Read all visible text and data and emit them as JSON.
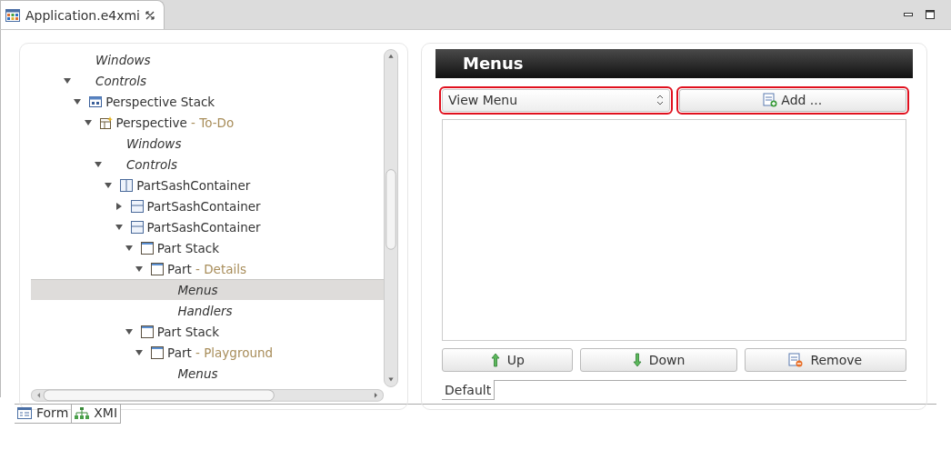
{
  "editor_tab": {
    "title": "Application.e4xmi",
    "selected": true
  },
  "tree": [
    {
      "label": "Windows",
      "kind": "folder",
      "selected": false
    },
    {
      "label": "Controls",
      "kind": "folder",
      "expanded": true,
      "selected": false,
      "children": [
        {
          "label": "Perspective Stack",
          "kind": "stack",
          "expanded": true,
          "selected": false,
          "children": [
            {
              "label": "Perspective",
              "detail": "- To-Do",
              "kind": "perspective",
              "expanded": true,
              "selected": false,
              "children": [
                {
                  "label": "Windows",
                  "kind": "folder",
                  "selected": false
                },
                {
                  "label": "Controls",
                  "kind": "folder",
                  "expanded": true,
                  "selected": false,
                  "children": [
                    {
                      "label": "PartSashContainer",
                      "kind": "sash-vertical",
                      "expanded": true,
                      "selected": false,
                      "children": [
                        {
                          "label": "PartSashContainer",
                          "kind": "sash-horizontal",
                          "expanded": false,
                          "selected": false
                        },
                        {
                          "label": "PartSashContainer",
                          "kind": "sash-horizontal",
                          "expanded": true,
                          "selected": false,
                          "children": [
                            {
                              "label": "Part Stack",
                              "kind": "part",
                              "expanded": true,
                              "selected": false,
                              "children": [
                                {
                                  "label": "Part",
                                  "detail": "- Details",
                                  "kind": "part",
                                  "expanded": true,
                                  "selected": false,
                                  "children": [
                                    {
                                      "label": "Menus",
                                      "kind": "folder",
                                      "selected": true
                                    },
                                    {
                                      "label": "Handlers",
                                      "kind": "folder",
                                      "selected": false
                                    }
                                  ]
                                }
                              ]
                            },
                            {
                              "label": "Part Stack",
                              "kind": "part",
                              "expanded": true,
                              "selected": false,
                              "children": [
                                {
                                  "label": "Part",
                                  "detail": "- Playground",
                                  "kind": "part",
                                  "expanded": true,
                                  "selected": false,
                                  "children": [
                                    {
                                      "label": "Menus",
                                      "kind": "folder",
                                      "selected": false
                                    }
                                  ]
                                }
                              ]
                            }
                          ]
                        }
                      ]
                    }
                  ]
                }
              ]
            }
          ]
        }
      ]
    }
  ],
  "details": {
    "title": "Menus",
    "menu_type": {
      "value": "View Menu",
      "highlighted": true
    },
    "add_button": {
      "label": "Add ...",
      "highlighted": true
    },
    "buttons": [
      {
        "label": "Up",
        "kind": "up"
      },
      {
        "label": "Down",
        "kind": "down"
      },
      {
        "label": "Remove",
        "kind": "remove"
      }
    ],
    "tabs": [
      {
        "label": "Default",
        "selected": true
      }
    ]
  },
  "bottom_tabs": [
    {
      "label": "Form",
      "kind": "form",
      "selected": false
    },
    {
      "label": "XMI",
      "kind": "xmi",
      "selected": true
    }
  ]
}
